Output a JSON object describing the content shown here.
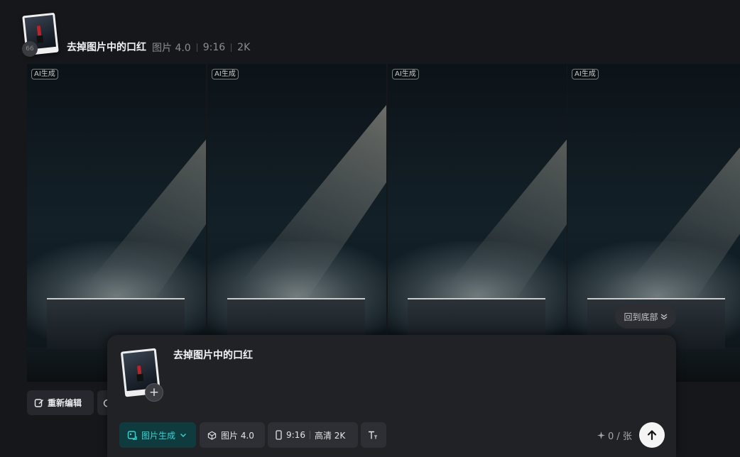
{
  "header": {
    "title": "去掉图片中的口红",
    "model": "图片 4.0",
    "ratio": "9:16",
    "resolution": "2K",
    "thumb_badge": "66"
  },
  "gallery": {
    "tiles": [
      {
        "ai_label": "AI生成"
      },
      {
        "ai_label": "AI生成"
      },
      {
        "ai_label": "AI生成"
      },
      {
        "ai_label": "AI生成"
      }
    ],
    "back_to_bottom": "回到底部"
  },
  "actions": {
    "reedit": "重新编辑"
  },
  "composer": {
    "prompt": "去掉图片中的口红",
    "mode": "图片生成",
    "model": "图片 4.0",
    "ratio": "9:16",
    "quality": "高清 2K",
    "credits": "0 / 张"
  },
  "colors": {
    "accent": "#2fd6d2",
    "accent_bg": "#0f3b3f",
    "background": "#16171b"
  }
}
